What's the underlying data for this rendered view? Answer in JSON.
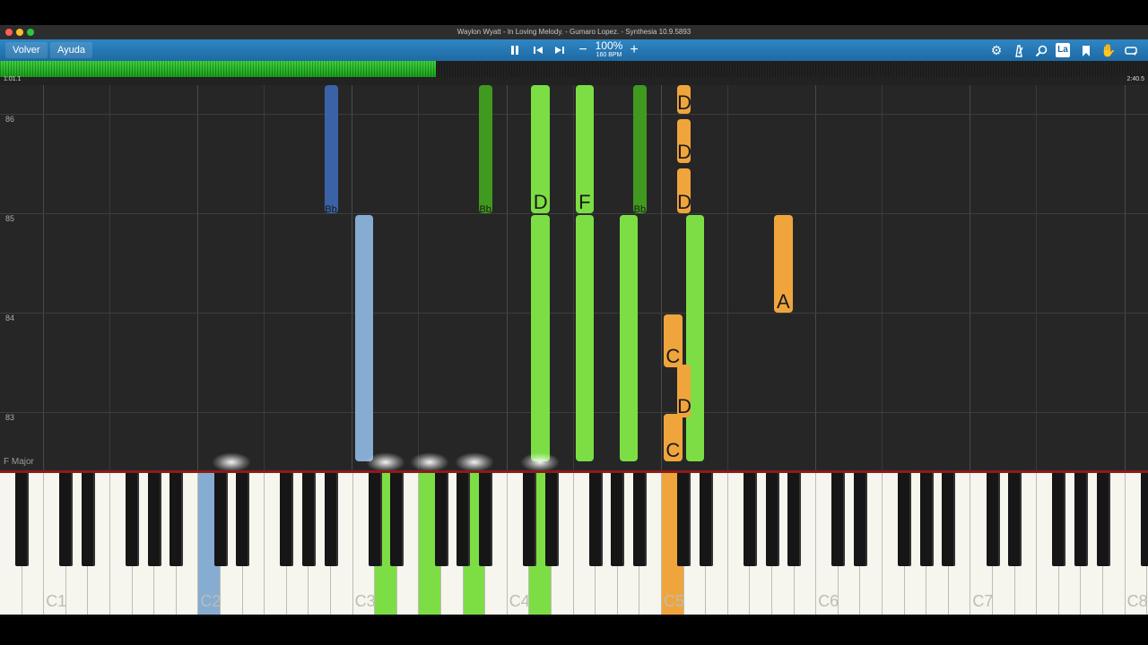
{
  "window": {
    "title": "Waylon Wyatt - In Loving Melody. - Gumaro Lopez. - Synthesia 10.9.5893",
    "dot_colors": [
      "#ff5f57",
      "#febc2e",
      "#28c840"
    ]
  },
  "toolbar": {
    "back_label": "Volver",
    "help_label": "Ayuda",
    "zoom": "100%",
    "bpm": "160 BPM",
    "hand_label": "La"
  },
  "progress": {
    "elapsed": "1:01.1",
    "total": "2:40.5",
    "fraction": 0.38
  },
  "roll": {
    "key_signature": "F Major",
    "measures": [
      "86",
      "85",
      "84",
      "83"
    ]
  },
  "notes": [
    {
      "pitch": "A#2",
      "label": "Bb",
      "color": "#3a62a6",
      "from": 86.58,
      "to": 85.0,
      "small": true
    },
    {
      "pitch": "A#3",
      "label": "Bb",
      "color": "#3f9a1f",
      "from": 86.58,
      "to": 85.0,
      "small": true
    },
    {
      "pitch": "D4",
      "label": "D",
      "color": "#7cde44",
      "from": 86.58,
      "to": 85.0,
      "small": false
    },
    {
      "pitch": "F4",
      "label": "F",
      "color": "#7cde44",
      "from": 86.58,
      "to": 85.0,
      "small": false
    },
    {
      "pitch": "A#4",
      "label": "Bb",
      "color": "#3f9a1f",
      "from": 86.58,
      "to": 85.0,
      "small": true
    },
    {
      "pitch": "C#5",
      "label": "D",
      "color": "#f0a53c",
      "from": 86.58,
      "to": 86.0,
      "small": false
    },
    {
      "pitch": "C#5",
      "label": "D",
      "color": "#f0a53c",
      "from": 85.95,
      "to": 85.5,
      "small": false
    },
    {
      "pitch": "C#5",
      "label": "D",
      "color": "#f0a53c",
      "from": 85.45,
      "to": 85.0,
      "small": false
    },
    {
      "pitch": "C3",
      "label": "",
      "color": "#86acd2",
      "from": 84.98,
      "to": 82.5,
      "small": false
    },
    {
      "pitch": "D4",
      "label": "",
      "color": "#7cde44",
      "from": 84.98,
      "to": 82.5,
      "small": false
    },
    {
      "pitch": "F4",
      "label": "",
      "color": "#7cde44",
      "from": 84.98,
      "to": 82.5,
      "small": false
    },
    {
      "pitch": "A4",
      "label": "",
      "color": "#7cde44",
      "from": 84.98,
      "to": 82.5,
      "small": false
    },
    {
      "pitch": "D5",
      "label": "",
      "color": "#7cde44",
      "from": 84.98,
      "to": 82.5,
      "small": false
    },
    {
      "pitch": "A5",
      "label": "A",
      "color": "#f0a53c",
      "from": 84.98,
      "to": 84.0,
      "small": false
    },
    {
      "pitch": "C5",
      "label": "C",
      "color": "#f0a53c",
      "from": 83.98,
      "to": 83.45,
      "small": false
    },
    {
      "pitch": "C#5",
      "label": "D",
      "color": "#f0a53c",
      "from": 83.48,
      "to": 82.95,
      "small": false
    },
    {
      "pitch": "C5",
      "label": "C",
      "color": "#f0a53c",
      "from": 82.98,
      "to": 82.5,
      "small": false
    }
  ],
  "keyboard": {
    "octave_labels": [
      "C1",
      "C2",
      "C3",
      "C4",
      "C5",
      "C6",
      "C7",
      "C8"
    ],
    "active_white": [
      {
        "key": 9,
        "color": "#86acd2"
      },
      {
        "key": 17,
        "color": "#7cde44"
      },
      {
        "key": 19,
        "color": "#7cde44"
      },
      {
        "key": 21,
        "color": "#7cde44"
      },
      {
        "key": 24,
        "color": "#7cde44"
      },
      {
        "key": 30,
        "color": "#f0a53c"
      }
    ],
    "pressed_tops": [
      "C3",
      "D4",
      "F4",
      "A4",
      "D5"
    ]
  }
}
